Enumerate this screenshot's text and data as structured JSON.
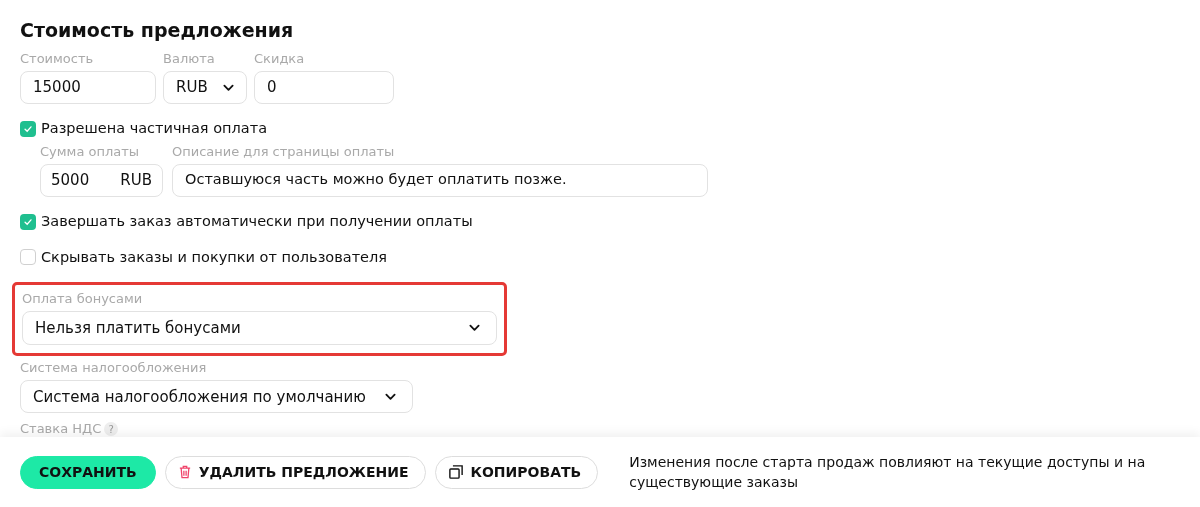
{
  "section_title": "Стоимость предложения",
  "price_fields": [
    {
      "kind": "input",
      "label": "Стоимость",
      "value": "15000"
    },
    {
      "kind": "select",
      "label": "Валюта",
      "value": "RUB"
    },
    {
      "kind": "input",
      "label": "Скидка",
      "value": "0"
    }
  ],
  "partial_payment": {
    "label": "Разрешена частичная оплата",
    "checked": true,
    "amount": {
      "label": "Сумма оплаты",
      "value": "5000",
      "unit": "RUB"
    },
    "description": {
      "label": "Описание для страницы оплаты",
      "value": "Оставшуюся часть можно будет оплатить позже."
    }
  },
  "options": [
    {
      "label": "Завершать заказ автоматически при получении оплаты",
      "checked": true
    },
    {
      "label": "Скрывать заказы и покупки от пользователя",
      "checked": false
    }
  ],
  "bonus_payment": {
    "label": "Оплата бонусами",
    "value": "Нельзя платить бонусами",
    "highlighted": true
  },
  "tax_system": {
    "label": "Система налогообложения",
    "value": "Система налогообложения по умолчанию"
  },
  "vat": {
    "label": "Ставка НДС",
    "help": "?"
  },
  "footer": {
    "buttons": [
      {
        "kind": "primary",
        "label": "СОХРАНИТЬ"
      },
      {
        "kind": "delete",
        "label": "УДАЛИТЬ ПРЕДЛОЖЕНИЕ"
      },
      {
        "kind": "copy",
        "label": "КОПИРОВАТЬ"
      }
    ],
    "note": "Изменения после старта продаж повлияют на текущие доступы и на существующие заказы"
  }
}
